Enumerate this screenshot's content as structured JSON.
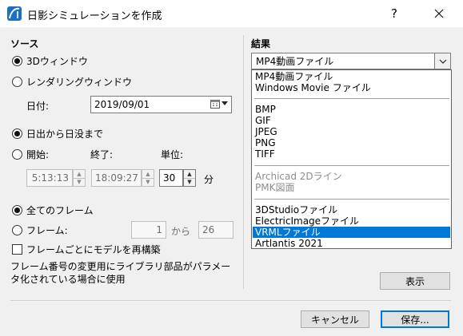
{
  "window": {
    "title": "日影シミュレーションを作成",
    "help": "?",
    "close_icon": "close-icon"
  },
  "source": {
    "heading": "ソース",
    "opt_3d": "3Dウィンドウ",
    "opt_render": "レンダリングウィンドウ",
    "date_label": "日付:",
    "date_value": "2019/09/01",
    "opt_sunrise": "日出から日没まで",
    "opt_start": "開始:",
    "end_label": "終了:",
    "unit_label": "単位:",
    "start_time": "5:13:13",
    "end_time": "18:09:27",
    "unit_value": "30",
    "minute": "分",
    "opt_all_frames": "全てのフレーム",
    "opt_frames": "フレーム:",
    "frame_from": "1",
    "frame_from_to": "から",
    "frame_to": "26",
    "rebuild_label": "フレームごとにモデルを再構築",
    "note": "フレーム番号の変更用にライブラリ部品がパラメータ化されている場合に使用"
  },
  "result": {
    "heading": "結果",
    "selected_format": "MP4動画ファイル",
    "options": [
      "MP4動画ファイル",
      "Windows Movie ファイル",
      "BMP",
      "GIF",
      "JPEG",
      "PNG",
      "TIFF",
      "Archicad 2Dライン",
      "PMK図面",
      "3DStudioファイル",
      "ElectricImageファイル",
      "VRMLファイル",
      "Artlantis 2021"
    ],
    "highlighted": "VRMLファイル",
    "show_button": "表示"
  },
  "footer": {
    "cancel": "キャンセル",
    "save": "保存..."
  },
  "colors": {
    "selection": "#0078d7",
    "dialog_bg": "#f0f0f0"
  }
}
